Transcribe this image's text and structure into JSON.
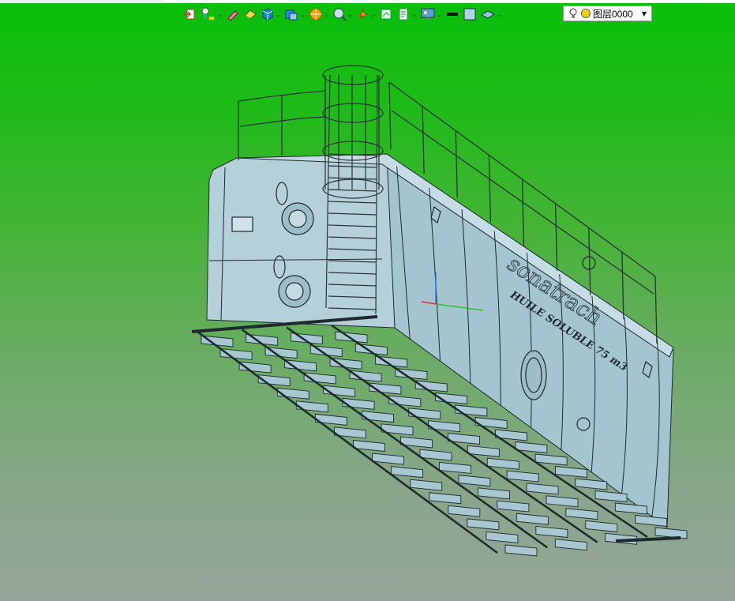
{
  "toolbar": {
    "items": [
      {
        "icon": "exit-icon"
      },
      {
        "icon": "lightbulb-pin-icon"
      },
      {
        "icon": "pencil-icon"
      },
      {
        "icon": "eraser-icon"
      },
      {
        "icon": "solid-cube-icon"
      },
      {
        "icon": "view-cube-icon"
      },
      {
        "icon": "sphere-section-icon"
      },
      {
        "icon": "zoom-icon"
      },
      {
        "icon": "axis-triad-icon"
      },
      {
        "icon": "fit-view-icon"
      },
      {
        "icon": "document-icon"
      },
      {
        "icon": "monitor-render-icon"
      },
      {
        "icon": "line-color-icon"
      },
      {
        "icon": "fill-color-icon"
      },
      {
        "icon": "layer-plane-icon"
      }
    ],
    "layer": {
      "name": "图层0000",
      "bulb": "on",
      "state_color": "#f5d200"
    }
  },
  "model": {
    "brand_text": "sonatrach",
    "sub_text": "HUILE SOLUBLE 75 m3",
    "body_color": "#a9c9d3",
    "edge_color": "#1e2a2e"
  },
  "colors": {
    "background_top": "#08bf08",
    "background_bottom": "#96a59a"
  }
}
